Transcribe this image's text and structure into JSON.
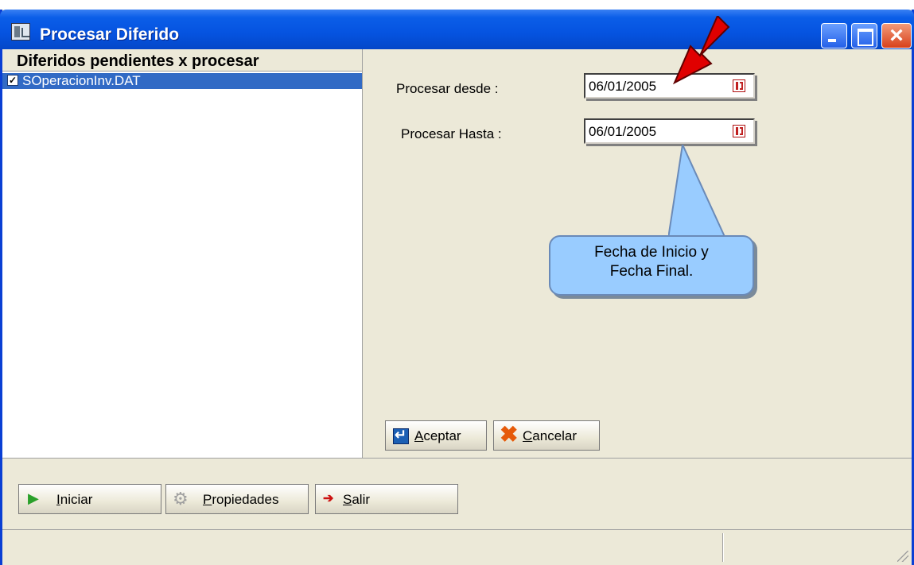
{
  "window": {
    "title": "Procesar Diferido"
  },
  "list": {
    "header": "Diferidos pendientes x procesar",
    "items": [
      {
        "label": "SOperacionInv.DAT",
        "checked": true
      }
    ]
  },
  "form": {
    "desde_label": "Procesar desde :",
    "desde_value": "06/01/2005",
    "hasta_label": "Procesar Hasta :",
    "hasta_value": "06/01/2005"
  },
  "callout": {
    "line1": "Fecha de Inicio y",
    "line2": "Fecha Final."
  },
  "buttons": {
    "aceptar_first": "A",
    "aceptar_rest": "ceptar",
    "cancelar_first": "C",
    "cancelar_rest": "ancelar",
    "iniciar_first": "I",
    "iniciar_rest": "niciar",
    "propiedades_first": "P",
    "propiedades_rest": "ropiedades",
    "salir_first": "S",
    "salir_rest": "alir"
  },
  "colors": {
    "titlebar": "#0553e0",
    "selection": "#316ac5",
    "callout": "#99ccff",
    "arrow": "#e00000"
  }
}
